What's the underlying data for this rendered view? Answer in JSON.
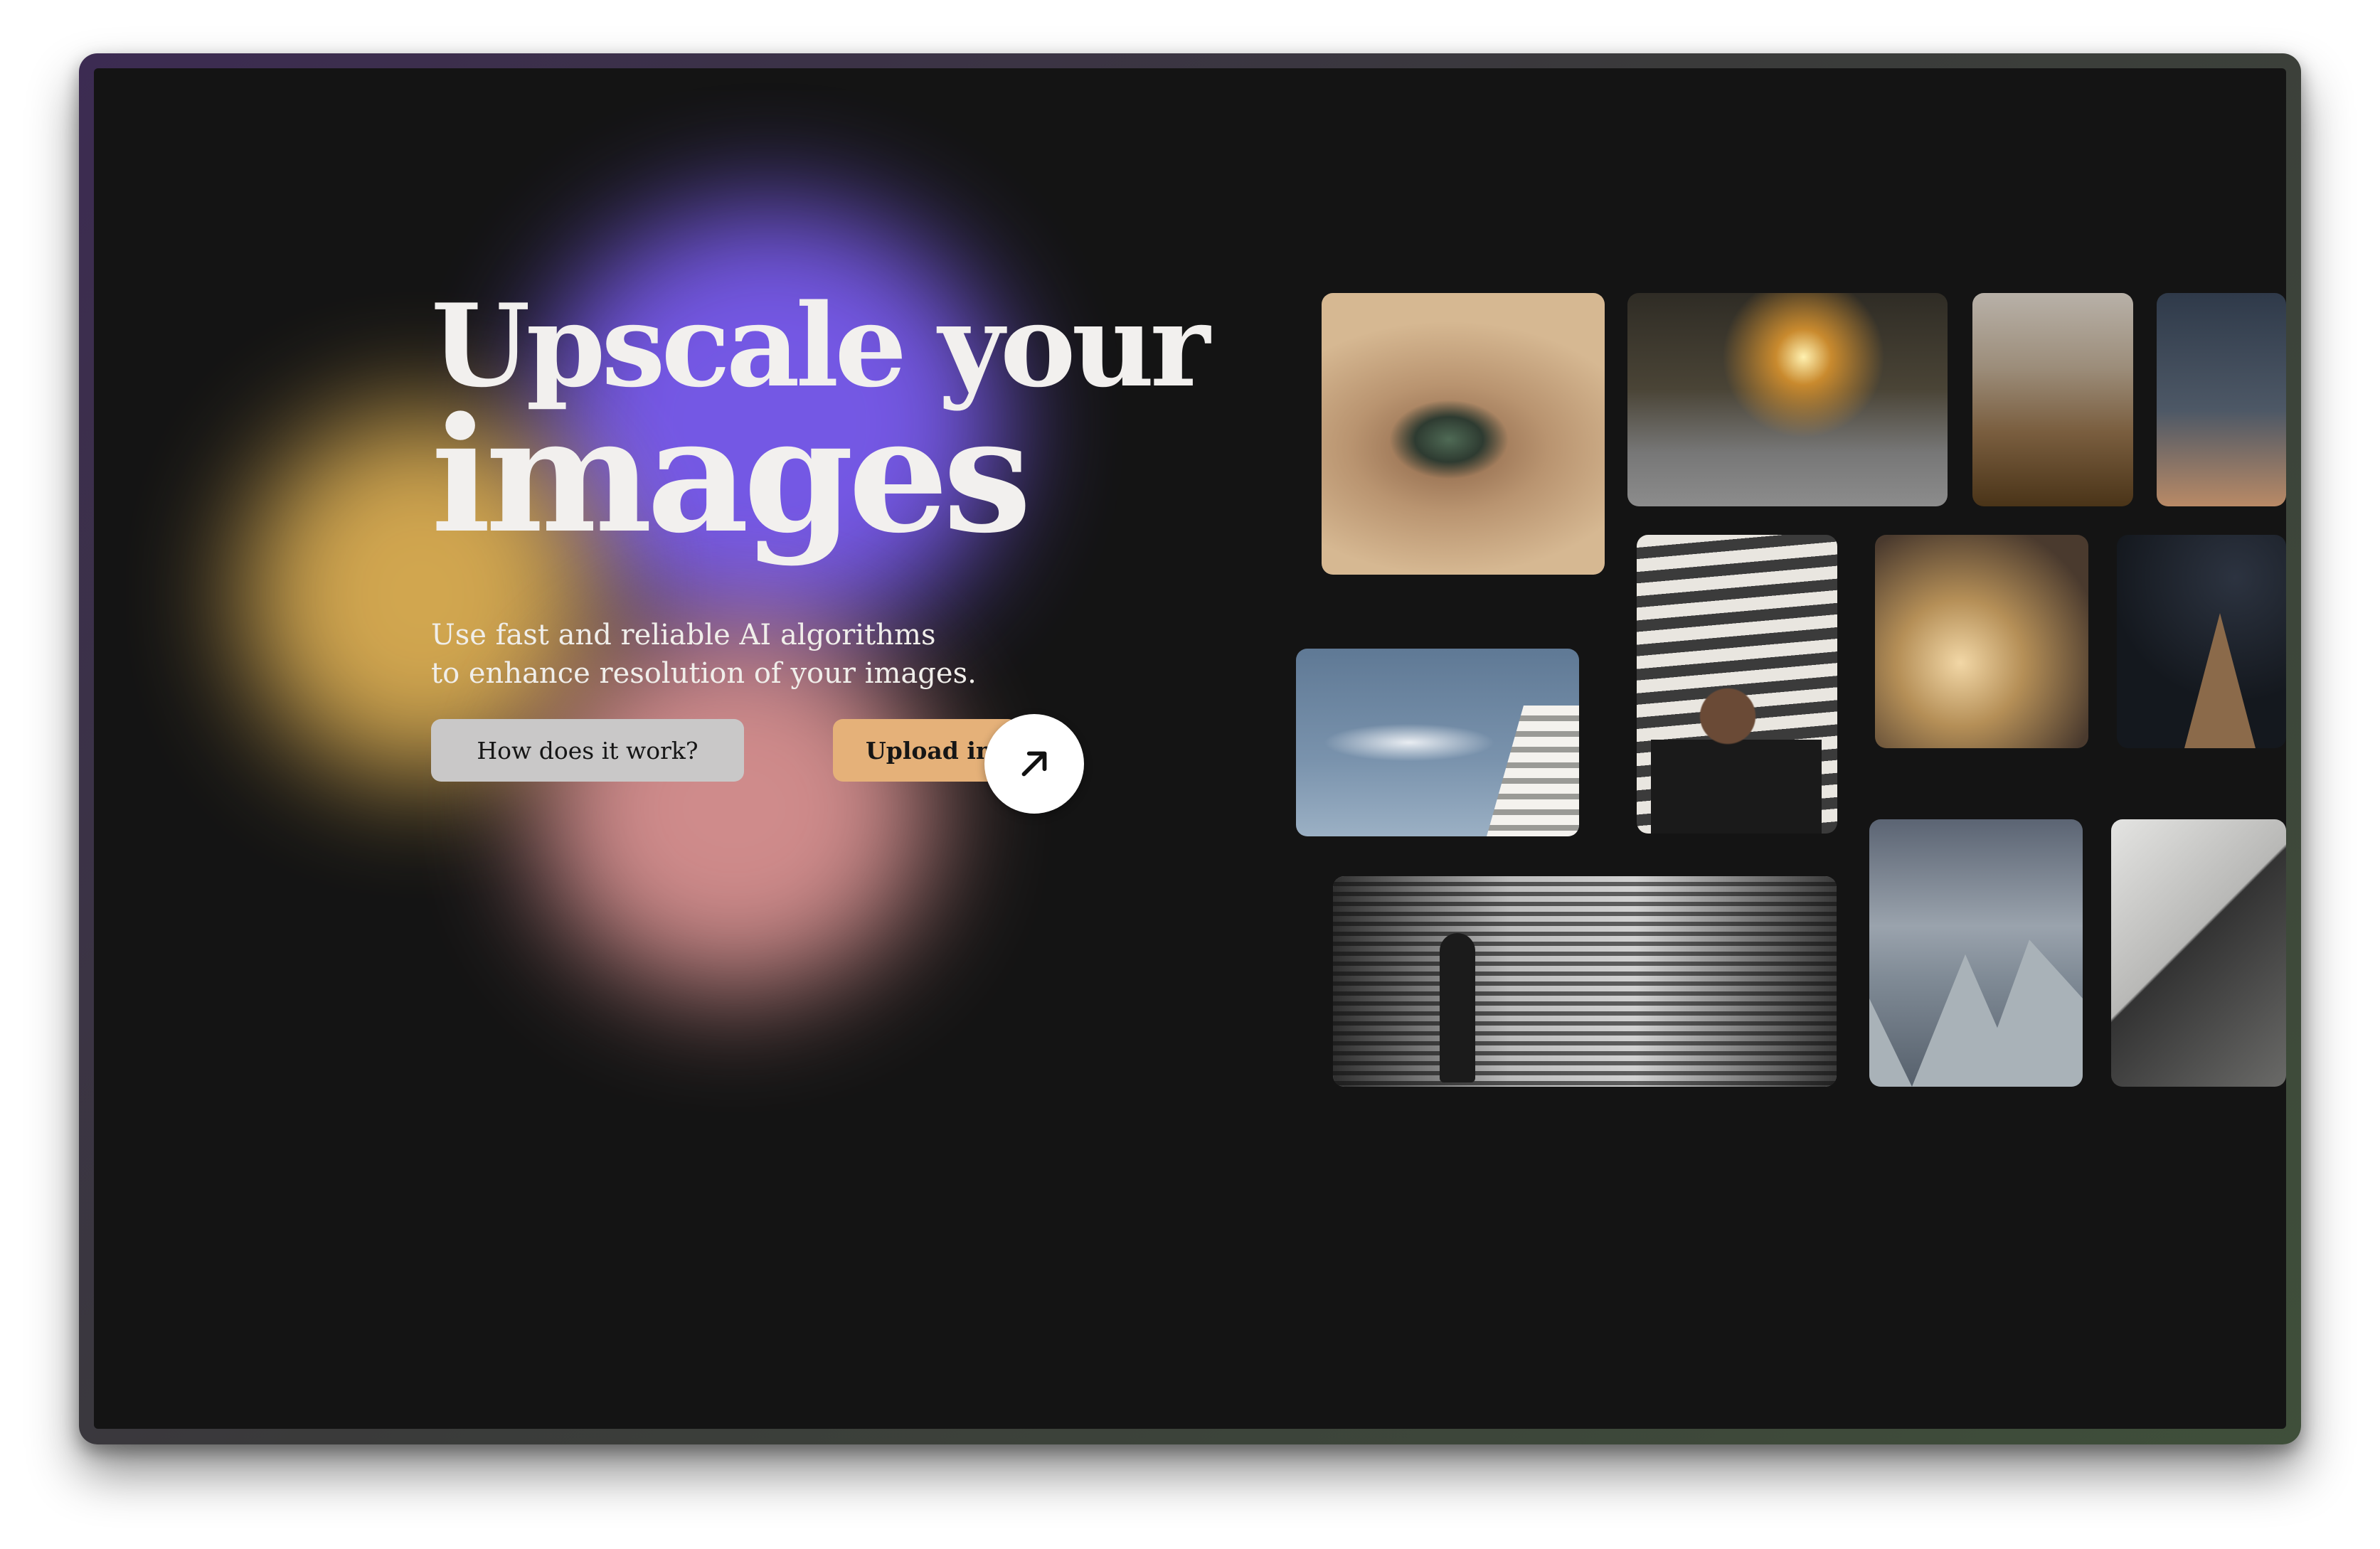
{
  "hero": {
    "title_line1": "Upscale your",
    "title_line2": "images",
    "subtitle_line1": "Use fast and reliable AI algorithms",
    "subtitle_line2": "to enhance resolution of your images."
  },
  "actions": {
    "how_label": "How does it work?",
    "upload_label": "Upload ima",
    "arrow_icon": "arrow-up-right-icon"
  },
  "colors": {
    "background": "#141414",
    "accent_upload": "#e5b179",
    "secondary_button": "#c9c8c8",
    "blob_purple": "#7a5cf0",
    "blob_yellow": "#e6b656",
    "blob_pink": "#f0a0a0"
  },
  "gallery": {
    "images": [
      "eye",
      "car",
      "hills",
      "sky-birds",
      "building-photographer",
      "drone",
      "church-cross",
      "cloud-tower",
      "stairs-figure",
      "spires",
      "brick-wall"
    ]
  }
}
